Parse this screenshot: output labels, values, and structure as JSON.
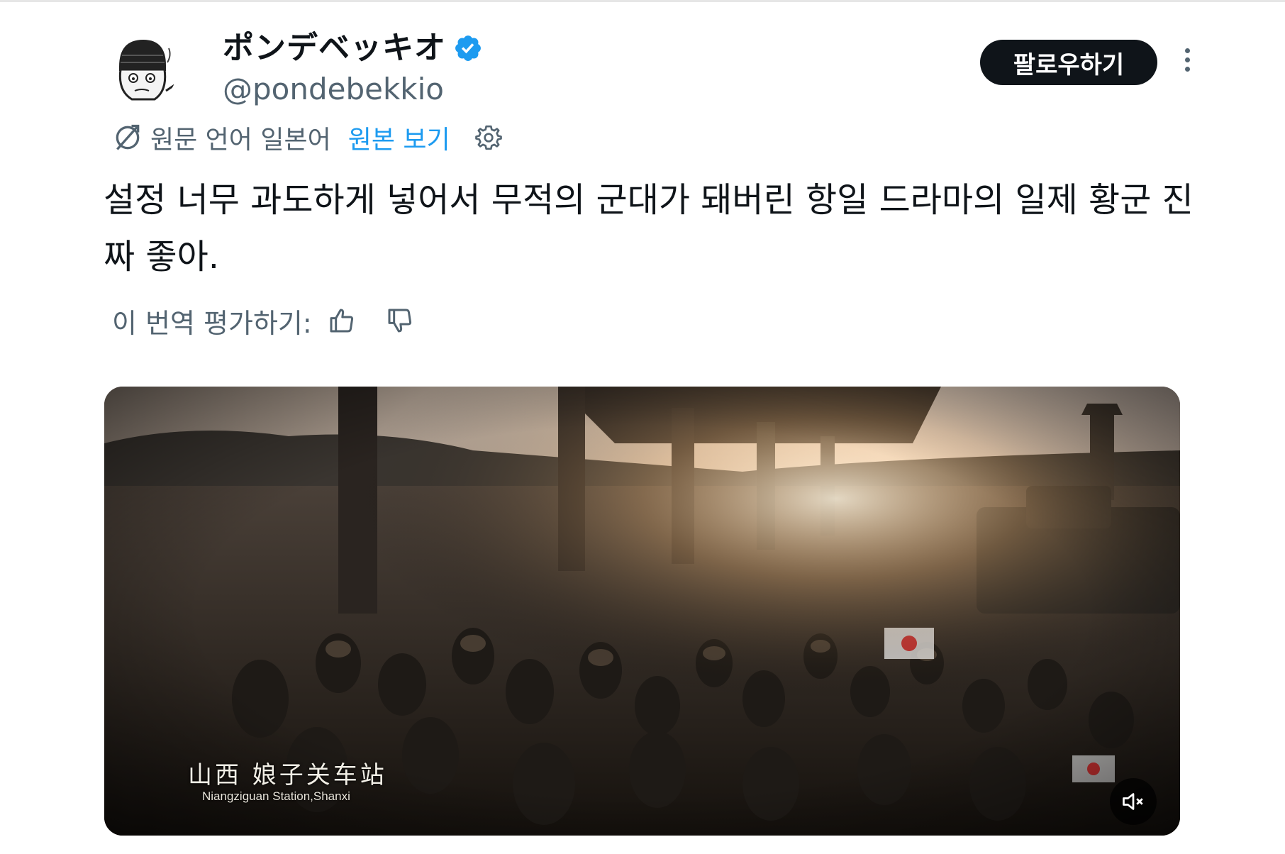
{
  "author": {
    "display_name": "ポンデベッキオ",
    "handle": "@pondebekkio"
  },
  "follow_button": {
    "label": "팔로우하기"
  },
  "translation": {
    "source_language_label": "원문 언어 일본어",
    "show_original_label": "원본 보기"
  },
  "tweet": {
    "text": "설정 너무 과도하게 넣어서 무적의 군대가 돼버린 항일 드라마의 일제 황군 진짜 좋아."
  },
  "rating": {
    "label": "이 번역 평가하기:"
  },
  "media": {
    "caption_chinese": "山西  娘子关车站",
    "caption_english": "Niangziguan Station,Shanxi",
    "muted": true
  },
  "icons": {
    "verified": "verified-badge-icon",
    "more": "more-options-icon",
    "translate": "translate-icon",
    "settings": "gear-icon",
    "thumbs_up": "thumbs-up-icon",
    "thumbs_down": "thumbs-down-icon",
    "mute": "speaker-muted-icon"
  },
  "colors": {
    "accent": "#1d9bf0",
    "text": "#0f1419",
    "muted_text": "#536471",
    "follow_bg": "#0f1419"
  }
}
